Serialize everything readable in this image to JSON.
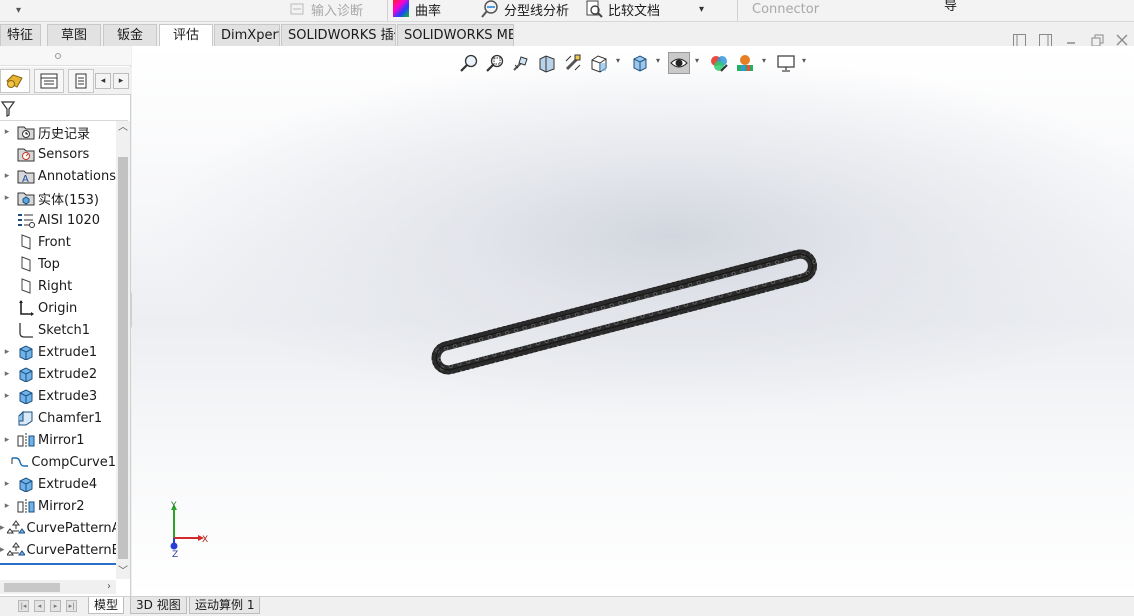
{
  "ribbon": {
    "input_diagnosis": "输入诊断",
    "curvature": "曲率",
    "parting_line_analysis": "分型线分析",
    "compare_documents": "比较文档",
    "connector": "Connector",
    "partial_text": "导"
  },
  "tabs": [
    {
      "label": "特征"
    },
    {
      "label": "草图"
    },
    {
      "label": "钣金"
    },
    {
      "label": "评估"
    },
    {
      "label": "DimXpert"
    },
    {
      "label": "SOLIDWORKS 插件"
    },
    {
      "label": "SOLIDWORKS MBD"
    }
  ],
  "active_tab": "评估",
  "feature_tree": [
    {
      "label": "历史记录",
      "icon": "history-folder-icon"
    },
    {
      "label": "Sensors",
      "icon": "sensor-icon"
    },
    {
      "label": "Annotations",
      "icon": "annotations-icon"
    },
    {
      "label": "实体(153)",
      "icon": "solid-bodies-icon"
    },
    {
      "label": "AISI 1020",
      "icon": "material-icon"
    },
    {
      "label": "Front",
      "icon": "plane-icon"
    },
    {
      "label": "Top",
      "icon": "plane-icon"
    },
    {
      "label": "Right",
      "icon": "plane-icon"
    },
    {
      "label": "Origin",
      "icon": "origin-icon"
    },
    {
      "label": "Sketch1",
      "icon": "sketch-icon"
    },
    {
      "label": "Extrude1",
      "icon": "extrude-icon"
    },
    {
      "label": "Extrude2",
      "icon": "extrude-icon"
    },
    {
      "label": "Extrude3",
      "icon": "extrude-icon"
    },
    {
      "label": "Chamfer1",
      "icon": "chamfer-icon"
    },
    {
      "label": "Mirror1",
      "icon": "mirror-icon"
    },
    {
      "label": "CompCurve1",
      "icon": "composite-curve-icon"
    },
    {
      "label": "Extrude4",
      "icon": "extrude-icon"
    },
    {
      "label": "Mirror2",
      "icon": "mirror-icon"
    },
    {
      "label": "CurvePatternA",
      "icon": "curve-pattern-icon"
    },
    {
      "label": "CurvePatternB",
      "icon": "curve-pattern-icon"
    }
  ],
  "triad": {
    "x": "X",
    "y": "Y",
    "z": "Z"
  },
  "bottom_tabs": [
    {
      "label": "模型"
    },
    {
      "label": "3D 视图"
    },
    {
      "label": "运动算例 1"
    }
  ],
  "active_bottom_tab": "模型",
  "colors": {
    "accent": "#2a6fc9",
    "x_axis": "#d12a2a",
    "y_axis": "#2aa52a",
    "z_axis": "#2a3fd1",
    "chain": "#2b2b2b"
  }
}
